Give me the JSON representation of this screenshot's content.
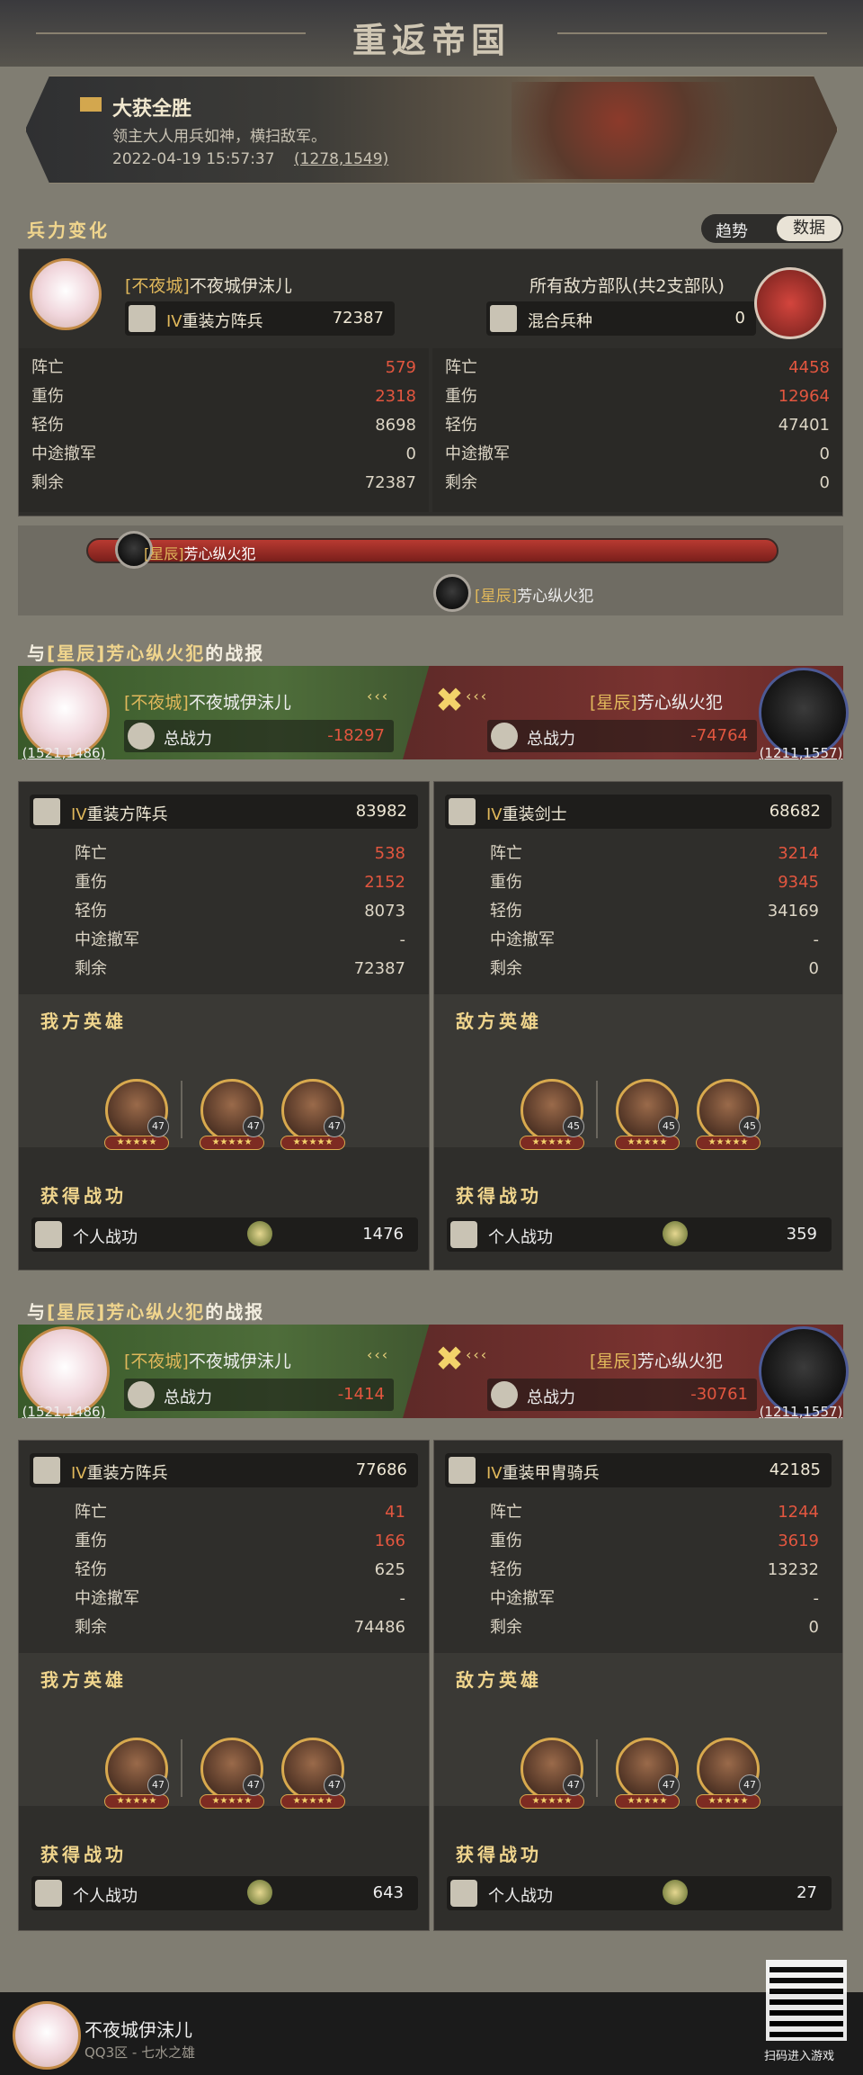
{
  "header": {
    "title": "重返帝国"
  },
  "banner": {
    "title": "大获全胜",
    "desc": "领主大人用兵如神，横扫敌军。",
    "time": "2022-04-19 15:57:37",
    "coord": "(1278,1549)"
  },
  "troops": {
    "section_title": "兵力变化",
    "toggle": {
      "trend": "趋势",
      "data": "数据"
    },
    "left": {
      "tag": "[不夜城]",
      "name": "不夜城伊沫儿",
      "unit_rank": "IV",
      "unit_name": "重装方阵兵",
      "unit_value": "72387",
      "stats": [
        {
          "label": "阵亡",
          "value": "579"
        },
        {
          "label": "重伤",
          "value": "2318"
        },
        {
          "label": "轻伤",
          "value": "8698"
        },
        {
          "label": "中途撤军",
          "value": "0"
        },
        {
          "label": "剩余",
          "value": "72387"
        }
      ]
    },
    "right": {
      "name": "所有敌方部队(共2支部队)",
      "unit_name": "混合兵种",
      "unit_value": "0",
      "stats": [
        {
          "label": "阵亡",
          "value": "4458"
        },
        {
          "label": "重伤",
          "value": "12964"
        },
        {
          "label": "轻伤",
          "value": "47401"
        },
        {
          "label": "中途撤军",
          "value": "0"
        },
        {
          "label": "剩余",
          "value": "0"
        }
      ]
    }
  },
  "progress": {
    "tag": "[星辰]",
    "name": "芳心纵火犯"
  },
  "reports": [
    {
      "prefix": "与",
      "enemy_tag": "[星辰]",
      "enemy_name": "芳心纵火犯",
      "suffix": "的战报",
      "left": {
        "tag": "[不夜城]",
        "name": "不夜城伊沫儿",
        "power_label": "总战力",
        "power": "-18297",
        "coord": "(1521,1486)"
      },
      "right": {
        "tag": "[星辰]",
        "name": "芳心纵火犯",
        "power_label": "总战力",
        "power": "-74764",
        "coord": "(1211,1557)"
      },
      "my_unit": {
        "rank": "IV",
        "name": "重装方阵兵",
        "value": "83982",
        "stats": [
          {
            "label": "阵亡",
            "value": "538"
          },
          {
            "label": "重伤",
            "value": "2152"
          },
          {
            "label": "轻伤",
            "value": "8073"
          },
          {
            "label": "中途撤军",
            "value": "-"
          },
          {
            "label": "剩余",
            "value": "72387"
          }
        ]
      },
      "enemy_unit": {
        "rank": "IV",
        "name": "重装剑士",
        "value": "68682",
        "stats": [
          {
            "label": "阵亡",
            "value": "3214"
          },
          {
            "label": "重伤",
            "value": "9345"
          },
          {
            "label": "轻伤",
            "value": "34169"
          },
          {
            "label": "中途撤军",
            "value": "-"
          },
          {
            "label": "剩余",
            "value": "0"
          }
        ]
      },
      "my_heroes_label": "我方英雄",
      "enemy_heroes_label": "敌方英雄",
      "my_heroes": [
        {
          "lv": "47"
        },
        {
          "lv": "47"
        },
        {
          "lv": "47"
        }
      ],
      "enemy_heroes": [
        {
          "lv": "45"
        },
        {
          "lv": "45"
        },
        {
          "lv": "45"
        }
      ],
      "merit_label": "获得战功",
      "merit_item": "个人战功",
      "my_merit": "1476",
      "enemy_merit": "359"
    },
    {
      "prefix": "与",
      "enemy_tag": "[星辰]",
      "enemy_name": "芳心纵火犯",
      "suffix": "的战报",
      "left": {
        "tag": "[不夜城]",
        "name": "不夜城伊沫儿",
        "power_label": "总战力",
        "power": "-1414",
        "coord": "(1521,1486)"
      },
      "right": {
        "tag": "[星辰]",
        "name": "芳心纵火犯",
        "power_label": "总战力",
        "power": "-30761",
        "coord": "(1211,1557)"
      },
      "my_unit": {
        "rank": "IV",
        "name": "重装方阵兵",
        "value": "77686",
        "stats": [
          {
            "label": "阵亡",
            "value": "41"
          },
          {
            "label": "重伤",
            "value": "166"
          },
          {
            "label": "轻伤",
            "value": "625"
          },
          {
            "label": "中途撤军",
            "value": "-"
          },
          {
            "label": "剩余",
            "value": "74486"
          }
        ]
      },
      "enemy_unit": {
        "rank": "IV",
        "name": "重装甲胄骑兵",
        "value": "42185",
        "stats": [
          {
            "label": "阵亡",
            "value": "1244"
          },
          {
            "label": "重伤",
            "value": "3619"
          },
          {
            "label": "轻伤",
            "value": "13232"
          },
          {
            "label": "中途撤军",
            "value": "-"
          },
          {
            "label": "剩余",
            "value": "0"
          }
        ]
      },
      "my_heroes_label": "我方英雄",
      "enemy_heroes_label": "敌方英雄",
      "my_heroes": [
        {
          "lv": "47"
        },
        {
          "lv": "47"
        },
        {
          "lv": "47"
        }
      ],
      "enemy_heroes": [
        {
          "lv": "47"
        },
        {
          "lv": "47"
        },
        {
          "lv": "47"
        }
      ],
      "merit_label": "获得战功",
      "merit_item": "个人战功",
      "my_merit": "643",
      "enemy_merit": "27"
    }
  ],
  "footer": {
    "name": "不夜城伊沫儿",
    "server": "QQ3区 - 七水之雄",
    "qr_text": "扫码进入游戏"
  }
}
